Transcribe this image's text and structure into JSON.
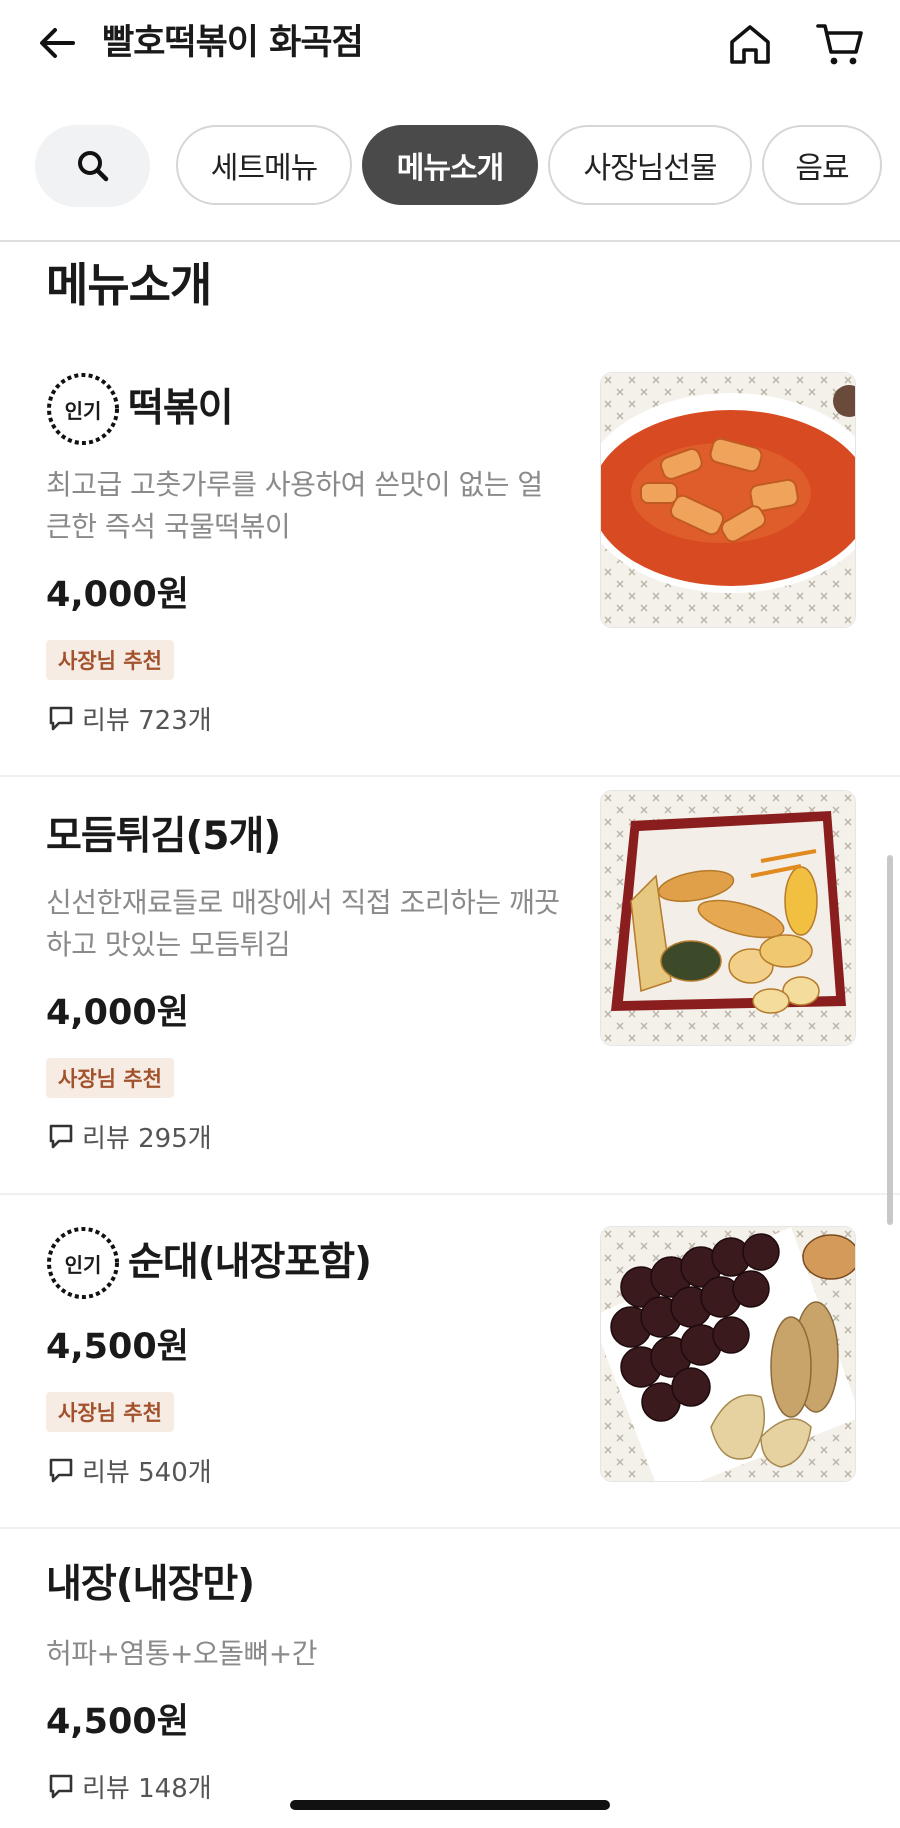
{
  "header": {
    "title": "빨호떡볶이 화곡점",
    "back_icon": "arrow-left-icon",
    "home_icon": "home-icon",
    "cart_icon": "cart-icon"
  },
  "tabs": {
    "search_icon": "search-icon",
    "items": [
      {
        "label": "세트메뉴",
        "active": false
      },
      {
        "label": "메뉴소개",
        "active": true
      },
      {
        "label": "사장님선물",
        "active": false
      },
      {
        "label": "음료",
        "active": false
      }
    ]
  },
  "section": {
    "title": "메뉴소개"
  },
  "items": [
    {
      "popular_label": "인기",
      "name": "떡볶이",
      "description": "최고급 고춧가루를 사용하여 쓴맛이 없는 얼큰한 즉석 국물떡볶이",
      "price": "4,000원",
      "badge": "사장님 추천",
      "reviews": "리뷰 723개"
    },
    {
      "name": "모듬튀김(5개)",
      "description": "신선한재료들로 매장에서 직접 조리하는 깨끗하고 맛있는 모듬튀김",
      "price": "4,000원",
      "badge": "사장님 추천",
      "reviews": "리뷰 295개"
    },
    {
      "popular_label": "인기",
      "name": "순대(내장포함)",
      "price": "4,500원",
      "badge": "사장님 추천",
      "reviews": "리뷰 540개"
    },
    {
      "name": "내장(내장만)",
      "description": "허파+염통+오돌뼈+간",
      "price": "4,500원",
      "reviews": "리뷰 148개"
    }
  ],
  "colors": {
    "active_tab": "#4a4a4a",
    "badge_bg": "#f6ece4",
    "badge_text": "#a2522c",
    "description": "#8a8a8a"
  }
}
